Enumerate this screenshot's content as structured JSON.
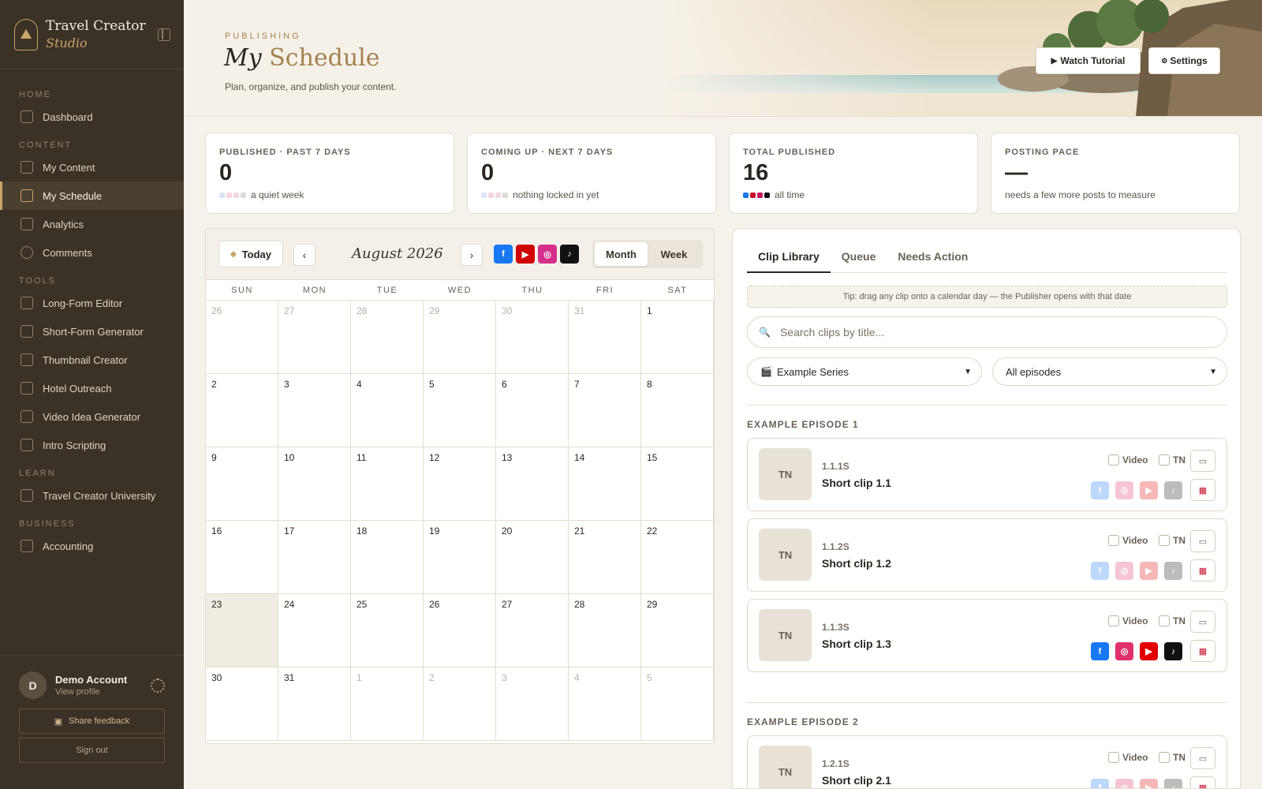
{
  "brand": {
    "title": "Travel Creator",
    "subtitle": "Studio"
  },
  "sidebar": {
    "sections": {
      "home": "HOME",
      "content": "CONTENT",
      "tools": "TOOLS",
      "learn": "LEARN",
      "business": "BUSINESS"
    },
    "items": {
      "dashboard": "Dashboard",
      "my_content": "My Content",
      "my_schedule": "My Schedule",
      "analytics": "Analytics",
      "comments": "Comments",
      "long_form_editor": "Long-Form Editor",
      "short_form_generator": "Short-Form Generator",
      "thumbnail_creator": "Thumbnail Creator",
      "hotel_outreach": "Hotel Outreach",
      "video_idea_generator": "Video Idea Generator",
      "intro_scripting": "Intro Scripting",
      "university": "Travel Creator University",
      "accounting": "Accounting"
    },
    "active_item": "My Schedule",
    "account": {
      "initial": "D",
      "name": "Demo Account",
      "link": "View profile",
      "feedback_label": "Share feedback",
      "signout_label": "Sign out"
    }
  },
  "header": {
    "eyebrow": "PUBLISHING",
    "title_italic": "My",
    "title_main": "Schedule",
    "subtitle": "Plan, organize, and publish your content.",
    "watch_tutorial": "Watch Tutorial",
    "settings": "Settings"
  },
  "stats": [
    {
      "label": "PUBLISHED · PAST 7 DAYS",
      "value": "0",
      "note": "a quiet week"
    },
    {
      "label": "COMING UP · NEXT 7 DAYS",
      "value": "0",
      "note": "nothing locked in yet"
    },
    {
      "label": "TOTAL PUBLISHED",
      "value": "16",
      "note": "all time"
    },
    {
      "label": "POSTING PACE",
      "value": "—",
      "note": "needs a few more posts to measure"
    }
  ],
  "calendar": {
    "today_label": "Today",
    "month_label": "August 2026",
    "prev_icon": "‹",
    "next_icon": "›",
    "view_month": "Month",
    "view_week": "Week",
    "active_view": "Month",
    "weekdays": [
      "SUN",
      "MON",
      "TUE",
      "WED",
      "THU",
      "FRI",
      "SAT"
    ],
    "days": [
      "26",
      "27",
      "28",
      "29",
      "30",
      "31",
      "1",
      "2",
      "3",
      "4",
      "5",
      "6",
      "7",
      "8",
      "9",
      "10",
      "11",
      "12",
      "13",
      "14",
      "15",
      "16",
      "17",
      "18",
      "19",
      "20",
      "21",
      "22",
      "23",
      "24",
      "25",
      "26",
      "27",
      "28",
      "29",
      "30",
      "31",
      "1",
      "2",
      "3",
      "4",
      "5"
    ],
    "platforms": [
      "facebook",
      "youtube",
      "instagram",
      "tiktok"
    ]
  },
  "library": {
    "tabs": [
      "Clip Library",
      "Queue",
      "Needs Action"
    ],
    "active_tab": "Clip Library",
    "tip": "Tip: drag any clip onto a calendar day — the Publisher opens with that date",
    "search_placeholder": "Search clips by title...",
    "series_select": "Example Series",
    "episode_select": "All episodes",
    "checkbox_video": "Video",
    "checkbox_tn": "TN",
    "episodes": [
      {
        "title": "EXAMPLE EPISODE 1",
        "clips": [
          {
            "thumb": "TN",
            "code": "1.1.1S",
            "name": "Short clip 1.1",
            "platforms_active": false
          },
          {
            "thumb": "TN",
            "code": "1.1.2S",
            "name": "Short clip 1.2",
            "platforms_active": false
          },
          {
            "thumb": "TN",
            "code": "1.1.3S",
            "name": "Short clip 1.3",
            "platforms_active": true
          }
        ]
      },
      {
        "title": "EXAMPLE EPISODE 2",
        "clips": [
          {
            "thumb": "TN",
            "code": "1.2.1S",
            "name": "Short clip 2.1",
            "platforms_active": false
          }
        ]
      }
    ]
  },
  "colors": {
    "sidebar_bg": "#3a3226",
    "accent_gold": "#c9a46a",
    "facebook": "#1877f2",
    "youtube": "#e00000",
    "instagram": "#e1306c",
    "tiktok": "#111111"
  }
}
